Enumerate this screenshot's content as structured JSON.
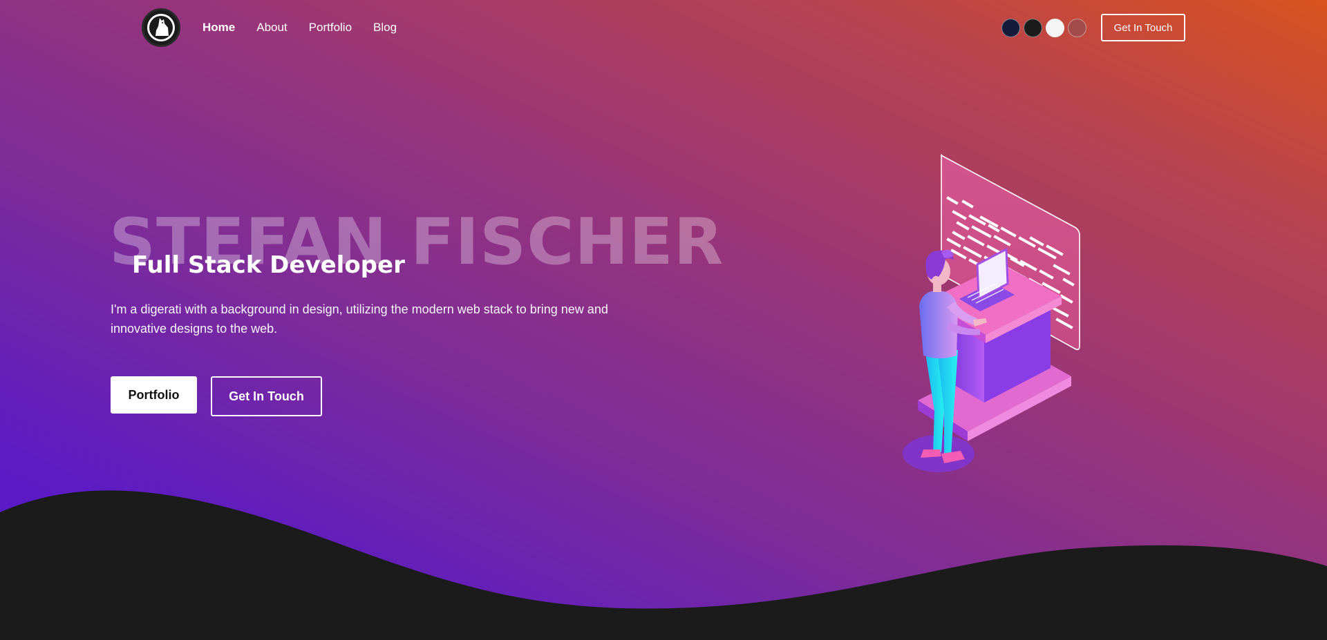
{
  "nav": {
    "links": [
      {
        "label": "Home",
        "active": true
      },
      {
        "label": "About",
        "active": false
      },
      {
        "label": "Portfolio",
        "active": false
      },
      {
        "label": "Blog",
        "active": false
      }
    ],
    "theme_swatches": [
      "#141c3a",
      "#1b1b1b",
      "#f5f5f5",
      "#a34a4a"
    ],
    "cta_label": "Get In Touch"
  },
  "hero": {
    "name": "STEFAN FISCHER",
    "title": "Full Stack Developer",
    "description": "I'm a digerati with a background in design, utilizing the modern web stack to bring new and innovative designs to the web.",
    "primary_button": "Portfolio",
    "secondary_button": "Get In Touch"
  },
  "colors": {
    "gradient_start": "#d9531e",
    "gradient_end": "#5516cc",
    "wave": "#1b1b1b"
  }
}
